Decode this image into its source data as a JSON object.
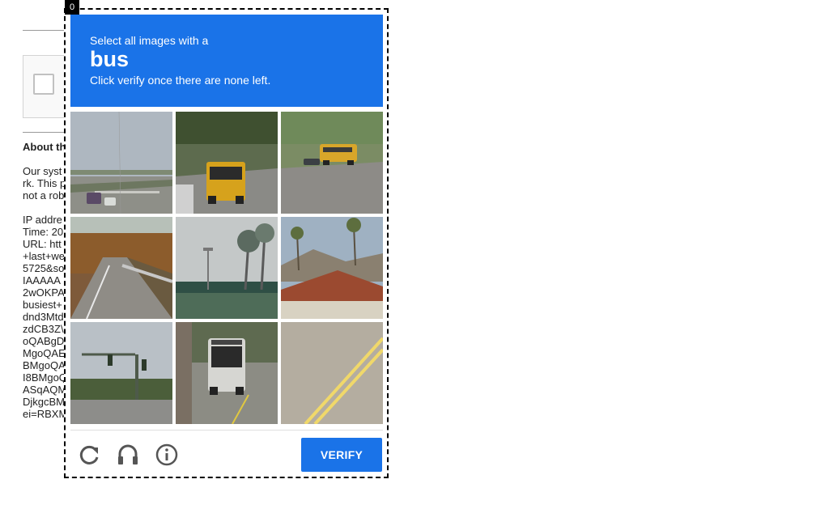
{
  "frame_index": "0",
  "background": {
    "heading": "About th",
    "paragraph": [
      "Our syst",
      "rk. This p",
      "not a rob"
    ],
    "details": [
      "IP addre",
      "Time: 20",
      "URL: htt",
      "+last+we",
      "5725&so",
      "IAAAAA",
      "2wOKPA",
      "busiest+",
      "dnd3Mtd",
      "zdCB3Z\\",
      "oQABgD",
      "MgoQAE",
      "BMgoQA",
      "I8BMgoQ",
      "ASqAQM",
      "DjkgcBM",
      "ei=RBXM"
    ]
  },
  "challenge": {
    "instruction": "Select all images with a",
    "keyword": "bus",
    "subtext": "Click verify once there are none left.",
    "tiles": [
      {
        "label": "highway with cars and trucks",
        "contains_target": false
      },
      {
        "label": "yellow school bus on road",
        "contains_target": true
      },
      {
        "label": "yellow school bus on highway",
        "contains_target": true
      },
      {
        "label": "road with guardrail and trees",
        "contains_target": false
      },
      {
        "label": "palm trees and fence",
        "contains_target": false
      },
      {
        "label": "house with red tile roof",
        "contains_target": false
      },
      {
        "label": "traffic lights at intersection",
        "contains_target": false
      },
      {
        "label": "city bus on street",
        "contains_target": true
      },
      {
        "label": "road markings",
        "contains_target": false
      }
    ],
    "footer": {
      "reload_icon": "reload-icon",
      "audio_icon": "headphones-icon",
      "info_icon": "info-icon",
      "verify_label": "Verify"
    }
  },
  "colors": {
    "accent": "#1a73e8",
    "header_text": "#ffffff"
  }
}
